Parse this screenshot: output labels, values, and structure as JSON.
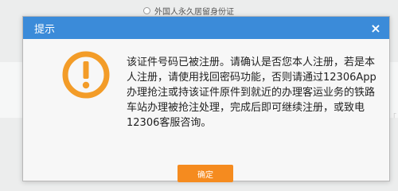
{
  "background": {
    "radio_label": "外国人永久居留身份证"
  },
  "dialog": {
    "title": "提示",
    "close_symbol": "×",
    "icon": "warning-icon",
    "message": "该证件号码已被注册。请确认是否您本人注册，若是本人注册，请使用找回密码功能，否则请通过12306App办理抢注或持该证件原件到就近的办理客运业务的铁路车站办理被抢注处理，完成后即可继续注册，或致电12306客服咨询。",
    "ok_label": "确定"
  },
  "colors": {
    "header": "#3b8bd9",
    "ok_button": "#f58b1f",
    "warning_icon": "#f39c28"
  }
}
